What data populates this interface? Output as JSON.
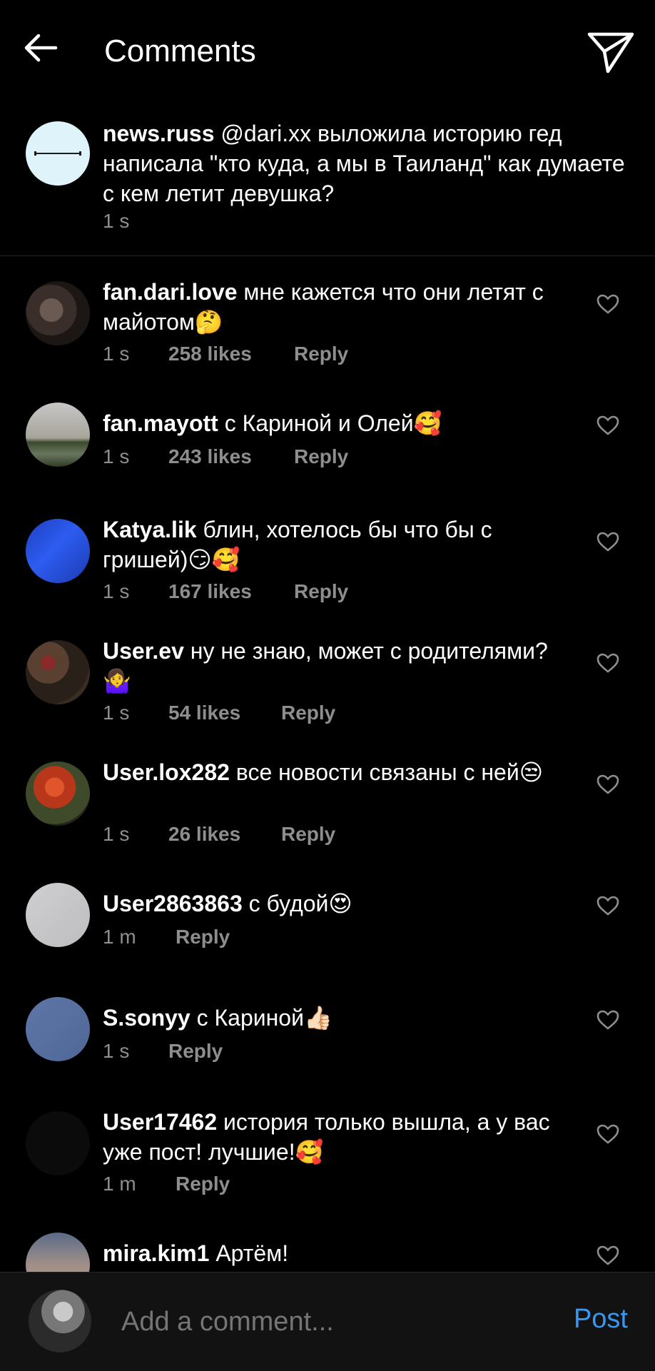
{
  "header": {
    "title": "Comments"
  },
  "caption": {
    "username": "news.russ",
    "text": "@dari.xx выложила историю гед написала \"кто куда, а мы в Таиланд\" как думаете с кем летит девушка?",
    "time": "1 s"
  },
  "comments": [
    {
      "username": "fan.dari.love",
      "text": "мне кажется что они летят с майотом",
      "emoji": "🤔",
      "time": "1 s",
      "likes": "258 likes",
      "reply": "Reply"
    },
    {
      "username": "fan.mayott",
      "text": "с Кариной и Олей",
      "emoji": "🥰",
      "time": "1 s",
      "likes": "243 likes",
      "reply": "Reply"
    },
    {
      "username": "Katya.lik",
      "text": "блин, хотелось бы что бы с гришей)",
      "emoji": "😏🥰",
      "time": "1 s",
      "likes": "167 likes",
      "reply": "Reply"
    },
    {
      "username": "User.ev",
      "text": "ну не знаю, может с родителями?",
      "emoji": "🤷‍♀️",
      "time": "1 s",
      "likes": "54 likes",
      "reply": "Reply"
    },
    {
      "username": "User.lox282",
      "text": "все новости связаны с ней",
      "emoji": "😒",
      "time": "1 s",
      "likes": "26 likes",
      "reply": "Reply"
    },
    {
      "username": "User2863863",
      "text": "с будой",
      "emoji": "😍",
      "time": "1 m",
      "likes": "",
      "reply": "Reply"
    },
    {
      "username": "S.sonyy",
      "text": "с Кариной",
      "emoji": "👍🏻",
      "time": "1 s",
      "likes": "",
      "reply": "Reply"
    },
    {
      "username": "User17462",
      "text": "история только вышла, а у вас уже пост! лучшие!",
      "emoji": "🥰",
      "time": "1 m",
      "likes": "",
      "reply": "Reply"
    },
    {
      "username": "mira.kim1",
      "text": "Артём!",
      "emoji": "",
      "time": "",
      "likes": "",
      "reply": ""
    }
  ],
  "composer": {
    "placeholder": "Add a comment...",
    "post_label": "Post"
  },
  "colors": {
    "background": "#000000",
    "muted_text": "#8e8e8e",
    "accent": "#3897f0"
  }
}
